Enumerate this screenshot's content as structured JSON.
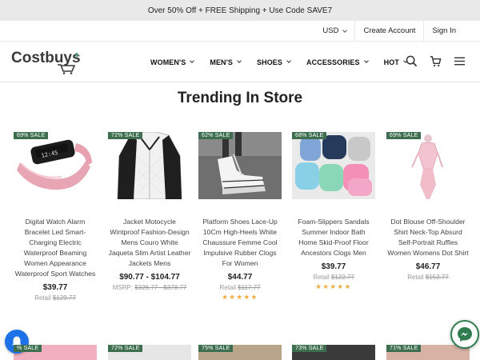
{
  "promo": {
    "text": "Over 50% Off + FREE Shipping + Use Code SAVE7"
  },
  "top_links": {
    "currency": "USD",
    "create_account": "Create Account",
    "sign_in": "Sign In"
  },
  "logo": {
    "text": "Costbuys"
  },
  "nav": [
    {
      "label": "WOMEN'S"
    },
    {
      "label": "MEN'S"
    },
    {
      "label": "SHOES"
    },
    {
      "label": "ACCESSORIES"
    },
    {
      "label": "HOT"
    }
  ],
  "section_title": "Trending In Store",
  "products": [
    {
      "badge": "69% SALE",
      "name": "Digital Watch Alarm Bracelet Led Smart-Charging Electric Waterproof Beaming Women Appearance Waterproof Sport Watches",
      "price": "$39.77",
      "compare_label": "Retail",
      "compare_price": "$129.77",
      "rating": 0
    },
    {
      "badge": "72% SALE",
      "name": "Jacket Motocycle Wintproof Fashion-Design Mens Couro White Jaqueta Slim Artist Leather Jackets Mens",
      "price": "$90.77 - $104.77",
      "compare_label": "MSRP:",
      "compare_price": "$326.77 - $378.77",
      "rating": 0
    },
    {
      "badge": "62% SALE",
      "name": "Platform Shoes Lace-Up 10Cm High-Heels White Chaussure Femme Cool Impulsive Rubber Clogs For Women",
      "price": "$44.77",
      "compare_label": "Retail",
      "compare_price": "$117.77",
      "rating": 5
    },
    {
      "badge": "68% SALE",
      "name": "Foam-Slippers Sandals Summer Indoor Bath Home Skid-Proof Floor Ancestors Clogs Men",
      "price": "$39.77",
      "compare_label": "Retail",
      "compare_price": "$122.77",
      "rating": 5
    },
    {
      "badge": "69% SALE",
      "name": "Dot Blouse Off-Shoulder Shirt Neck-Top Absurd Self-Portrait Ruffles Women Womens Dot Shirt",
      "price": "$46.77",
      "compare_label": "Retail",
      "compare_price": "$152.77",
      "rating": 0
    }
  ],
  "row2_badges": [
    "% SALE",
    "72% SALE",
    "75% SALE",
    "73% SALE",
    "71% SALE"
  ],
  "stars_glyph": "★★★★★",
  "colors": {
    "badge": "#3d6e4f",
    "star": "#f0a93e",
    "bell": "#1d72e8",
    "messenger_ring": "#2f7d4f"
  },
  "icons": {
    "search": "search-icon",
    "cart": "cart-icon",
    "menu": "hamburger-menu-icon",
    "bell": "bell-icon",
    "messenger": "messenger-icon"
  }
}
